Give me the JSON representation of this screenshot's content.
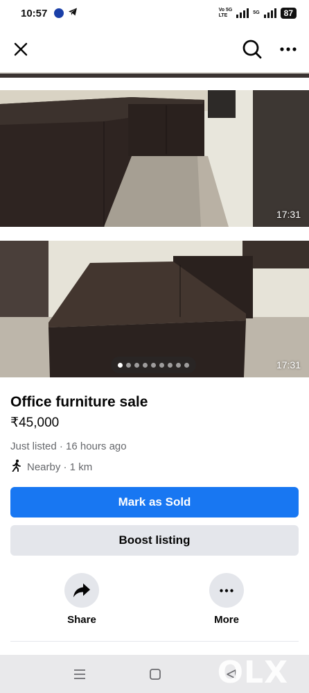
{
  "status_bar": {
    "time": "10:57",
    "network_line1": "Vo 5G",
    "network_line2": "LTE",
    "network_type": "5G",
    "battery": "87"
  },
  "app_bar": {
    "icons": [
      "close-icon",
      "search-icon",
      "more-icon"
    ]
  },
  "gallery": {
    "photos": [
      {
        "timestamp": "17:31"
      },
      {
        "timestamp": "17:31"
      }
    ],
    "page_count": 9,
    "active_index": 0
  },
  "listing": {
    "title": "Office furniture sale",
    "price": "₹45,000",
    "listed": "Just listed · 16 hours ago",
    "distance": "Nearby · 1 km"
  },
  "buttons": {
    "primary": "Mark as Sold",
    "secondary": "Boost listing"
  },
  "actions": [
    {
      "label": "Share",
      "icon": "share-icon"
    },
    {
      "label": "More",
      "icon": "more-icon"
    }
  ],
  "watermark": "OLX",
  "colors": {
    "primary": "#1877f2",
    "secondary_bg": "#e4e6eb",
    "muted_text": "#65676b"
  }
}
